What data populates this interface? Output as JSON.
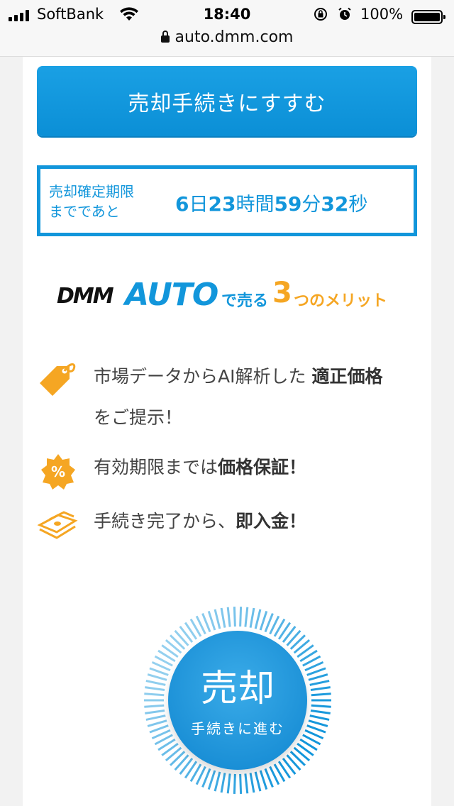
{
  "status_bar": {
    "carrier": "SoftBank",
    "time": "18:40",
    "battery": "100%"
  },
  "browser": {
    "url": "auto.dmm.com"
  },
  "cta_top": {
    "label": "売却手続きにすすむ"
  },
  "deadline": {
    "label_line1": "売却確定期限",
    "label_line2": "までであと",
    "days": "6",
    "days_unit": "日",
    "hours": "23",
    "hours_unit": "時間",
    "minutes": "59",
    "minutes_unit": "分",
    "seconds": "32",
    "seconds_unit": "秒"
  },
  "logo": {
    "brand_dmm": "DMM",
    "brand_auto": "AUTO",
    "sub_de_uru": "で売る",
    "three": "3",
    "merit": "つのメリット"
  },
  "merits": [
    {
      "icon": "price-tag-icon",
      "text_before": "市場データからAI解析した ",
      "bold": "適正価格",
      "text_after": " をご提示！"
    },
    {
      "icon": "percent-badge-icon",
      "text_before": "有効期限までは",
      "bold": "価格保証！",
      "text_after": ""
    },
    {
      "icon": "money-bills-icon",
      "text_before": "手続き完了から、",
      "bold": "即入金！",
      "text_after": ""
    }
  ],
  "sell_button": {
    "main": "売却",
    "sub": "手続きに進む"
  },
  "colors": {
    "brand_blue": "#1296db",
    "accent_orange": "#f5a623"
  }
}
